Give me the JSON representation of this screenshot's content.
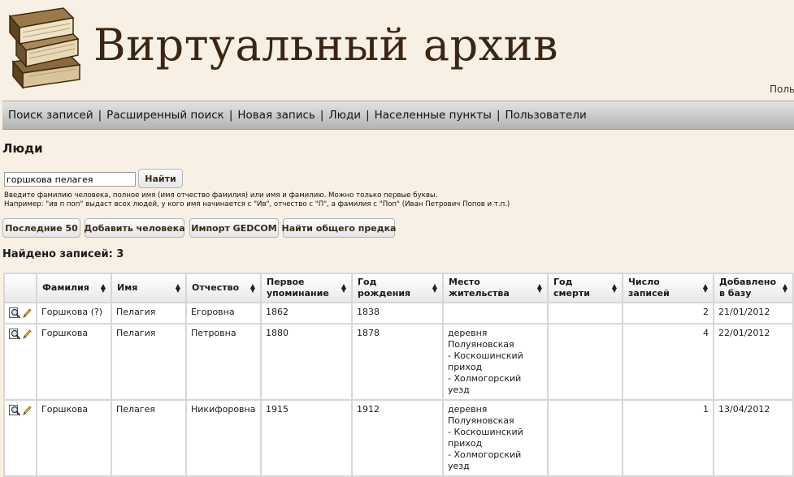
{
  "site": {
    "title": "Виртуальный архив",
    "user_link": "Польз"
  },
  "nav": {
    "items": [
      "Поиск записей",
      "Расширенный поиск",
      "Новая запись",
      "Люди",
      "Населенные пункты",
      "Пользователи"
    ],
    "separator": "|"
  },
  "page": {
    "title": "Люди",
    "search_value": "горшкова пелагея",
    "search_button": "Найти",
    "hint1": "Введите фамилию человека, полное имя (имя отчество фамилия) или имя и фамилию. Можно только первые буквы.",
    "hint2": "Например: \"ив п поп\" выдаст всех людей, у кого имя начинается с \"Ив\", отчество с \"П\", а фамилия с \"Поп\" (Иван Петрович Попов и т.п.)",
    "actions": {
      "last50": "Последние 50",
      "add_person": "Добавить человека",
      "import_gedcom": "Импорт GEDCOM",
      "find_ancestor": "Найти общего предка"
    },
    "found": "Найдено записей: 3"
  },
  "table": {
    "headers": {
      "surname": "Фамилия",
      "name": "Имя",
      "patronymic": "Отчество",
      "first_mention": "Первое упоминание",
      "birth_year": "Год рождения",
      "residence": "Место жительства",
      "death_year": "Год смерти",
      "records": "Число записей",
      "added": "Добавлено в базу"
    },
    "rows": [
      {
        "surname": "Горшкова (?)",
        "name": "Пелагия",
        "patronymic": "Егоровна",
        "first_mention": "1862",
        "birth_year": "1838",
        "residence": [
          "",
          "",
          ""
        ],
        "death_year": "",
        "records": "2",
        "added": "21/01/2012",
        "extra": "v"
      },
      {
        "surname": "Горшкова",
        "name": "Пелагия",
        "patronymic": "Петровна",
        "first_mention": "1880",
        "birth_year": "1878",
        "residence": [
          "деревня Полуяновская",
          "- Коскошинский приход",
          "- Холмогорский уезд"
        ],
        "death_year": "",
        "records": "4",
        "added": "22/01/2012",
        "extra": "v"
      },
      {
        "surname": "Горшкова",
        "name": "Пелагея",
        "patronymic": "Никифоровна",
        "first_mention": "1915",
        "birth_year": "1912",
        "residence": [
          "деревня Полуяновская",
          "- Коскошинский приход",
          "- Холмогорский уезд"
        ],
        "death_year": "",
        "records": "1",
        "added": "13/04/2012",
        "extra": "v"
      }
    ]
  },
  "colors": {
    "background": "#f8f0e4",
    "title": "#3b2613",
    "border": "#d7d7d7"
  }
}
